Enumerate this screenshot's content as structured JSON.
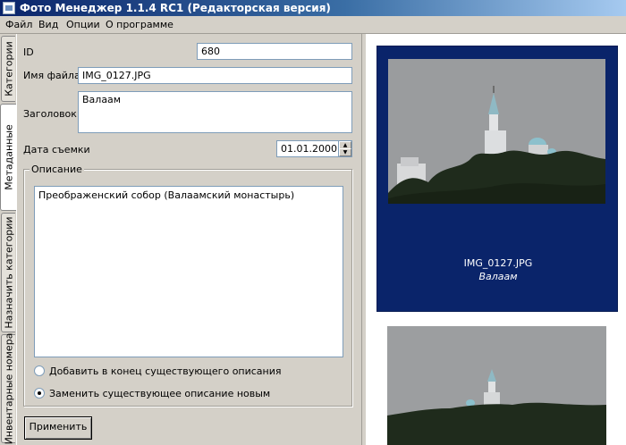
{
  "window": {
    "title": "Фото Менеджер 1.1.4 RC1 (Редакторская версия)"
  },
  "menu": {
    "items": [
      "Файл",
      "Вид",
      "Опции",
      "О программе"
    ]
  },
  "side_tabs": {
    "items": [
      "Категории",
      "Метаданные",
      "Назначить категории",
      "Инвентарные номера"
    ],
    "active": "Метаданные"
  },
  "metadata": {
    "id_label": "ID",
    "id_value": "680",
    "filename_label": "Имя файла",
    "filename_value": "IMG_0127.JPG",
    "title_label": "Заголовок",
    "title_value": "Валаам",
    "date_label": "Дата съемки",
    "date_value": "01.01.2000",
    "description_group": "Описание",
    "description_value": "Преображенский собор (Валаамский монастырь)",
    "radio_append": "Добавить в конец существующего описания",
    "radio_replace": "Заменить существующее описание новым",
    "radio_selected": "replace",
    "apply_button": "Применить"
  },
  "thumbnails": [
    {
      "filename": "IMG_0127.JPG",
      "title": "Валаам",
      "selected": true
    },
    {
      "filename": "",
      "title": "",
      "selected": false
    }
  ],
  "colors": {
    "selection": "#0a246a",
    "title_bar": "#0a246a",
    "face": "#d4d0c8"
  }
}
